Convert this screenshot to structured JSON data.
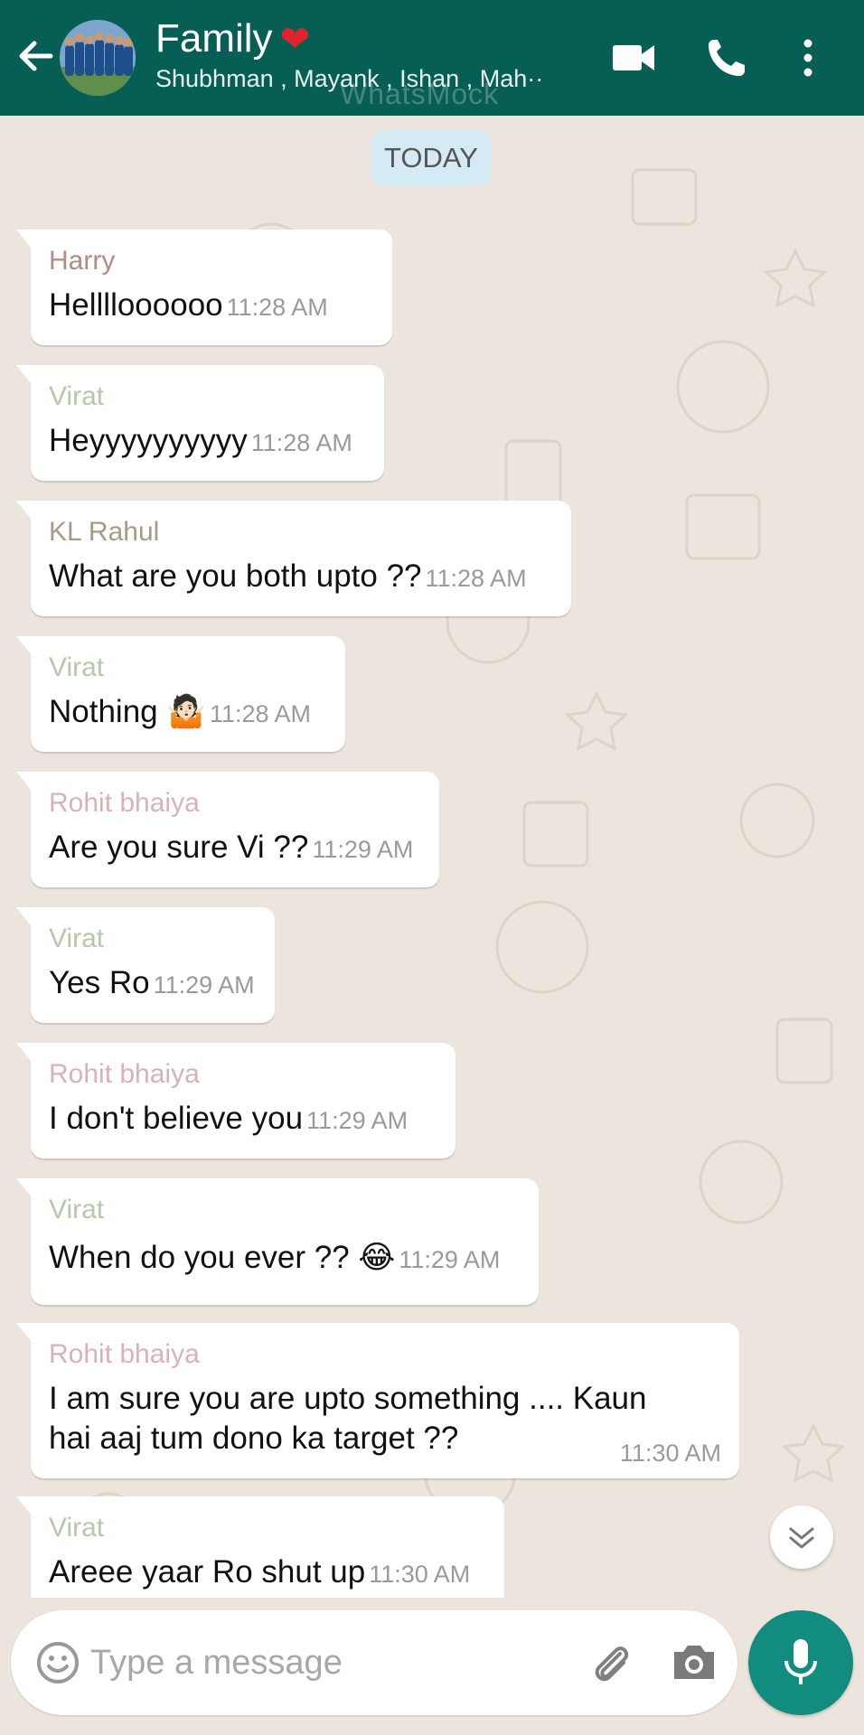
{
  "header": {
    "title": "Family",
    "heart": "❤",
    "subtitle": "Shubhman , Mayank , Ishan , Mah··",
    "watermark": "WhatsMock"
  },
  "chat": {
    "date_chip": "TODAY",
    "messages": [
      {
        "sender": "Harry",
        "sender_color": "#b58a86",
        "text": "Helllloooooo",
        "time": "11:28 AM"
      },
      {
        "sender": "Virat",
        "sender_color": "#b5c9a8",
        "text": "Heyyyyyyyyyy",
        "time": "11:28 AM"
      },
      {
        "sender": "KL Rahul",
        "sender_color": "#a99a86",
        "text": "What are you both upto ??",
        "time": "11:28 AM"
      },
      {
        "sender": "Virat",
        "sender_color": "#b5c9a8",
        "text": "Nothing 🤷🏻",
        "time": "11:28 AM"
      },
      {
        "sender": "Rohit bhaiya",
        "sender_color": "#d8b2b6",
        "text": "Are you sure Vi ??",
        "time": "11:29 AM"
      },
      {
        "sender": "Virat",
        "sender_color": "#b5c9a8",
        "text": "Yes Ro",
        "time": "11:29 AM"
      },
      {
        "sender": "Rohit bhaiya",
        "sender_color": "#d8b2b6",
        "text": "I don't believe you",
        "time": "11:29 AM"
      },
      {
        "sender": "Virat",
        "sender_color": "#b5c9a8",
        "text": "When do you ever ?? 😂",
        "time": "11:29 AM"
      },
      {
        "sender": "Rohit bhaiya",
        "sender_color": "#d8b2b6",
        "text": "I am sure you are upto something .... Kaun hai aaj tum dono ka target ??",
        "time": "11:30 AM"
      },
      {
        "sender": "Virat",
        "sender_color": "#b5c9a8",
        "text": "Areee yaar Ro shut up",
        "time": "11:30 AM"
      }
    ]
  },
  "input": {
    "placeholder": "Type a message"
  },
  "colors": {
    "header_bg": "#075e54",
    "chat_bg": "#ece5dd",
    "mic_bg": "#128c7e",
    "date_chip_bg": "#d4eaf4"
  },
  "icons": [
    "back-arrow-icon",
    "video-call-icon",
    "phone-call-icon",
    "more-vert-icon",
    "chevron-double-down-icon",
    "emoji-icon",
    "attach-icon",
    "camera-icon",
    "mic-icon"
  ]
}
